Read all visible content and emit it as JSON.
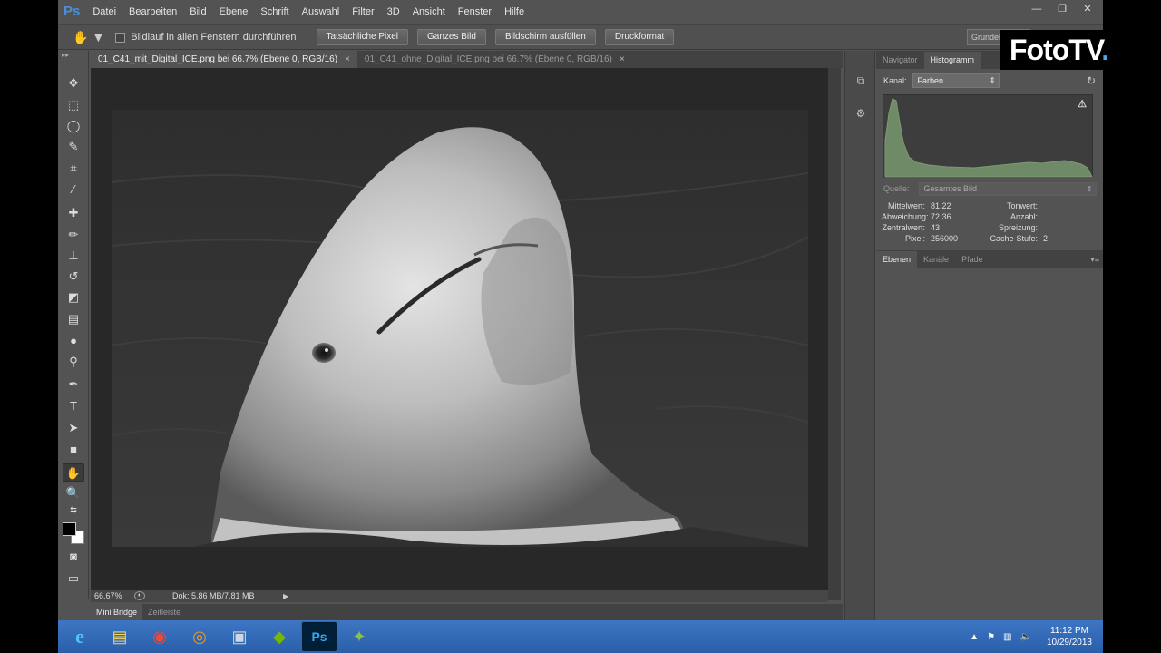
{
  "app": {
    "logo": "Ps"
  },
  "menu": [
    "Datei",
    "Bearbeiten",
    "Bild",
    "Ebene",
    "Schrift",
    "Auswahl",
    "Filter",
    "3D",
    "Ansicht",
    "Fenster",
    "Hilfe"
  ],
  "window_controls": {
    "minimize": "—",
    "restore": "❐",
    "close": "✕"
  },
  "options": {
    "scroll_all_windows_label": "Bildlauf in allen Fenstern durchführen",
    "buttons": [
      "Tatsächliche Pixel",
      "Ganzes Bild",
      "Bildschirm ausfüllen",
      "Druckformat"
    ],
    "workspace": "Grundelemente"
  },
  "tabs": [
    {
      "label": "01_C41_mit_Digital_ICE.png bei 66.7% (Ebene 0, RGB/16)",
      "close": "×",
      "active": true
    },
    {
      "label": "01_C41_ohne_Digital_ICE.png bei 66.7% (Ebene 0, RGB/16)",
      "close": "×",
      "active": false
    }
  ],
  "status": {
    "zoom": "66.67%",
    "doc_size": "Dok: 5.86 MB/7.81 MB",
    "arrow": "▶"
  },
  "bottom_tabs": [
    "Mini Bridge",
    "Zeitleiste"
  ],
  "navigator_tabs": [
    "Navigator",
    "Histogramm"
  ],
  "histogram": {
    "channel_label": "Kanal:",
    "channel_value": "Farben",
    "source_label": "Quelle:",
    "source_value": "Gesamtes Bild",
    "stats_left": [
      {
        "label": "Mittelwert:",
        "value": "81.22"
      },
      {
        "label": "Abweichung:",
        "value": "72.36"
      },
      {
        "label": "Zentralwert:",
        "value": "43"
      },
      {
        "label": "Pixel:",
        "value": "256000"
      }
    ],
    "stats_right": [
      {
        "label": "Tonwert:",
        "value": ""
      },
      {
        "label": "Anzahl:",
        "value": ""
      },
      {
        "label": "Spreizung:",
        "value": ""
      },
      {
        "label": "Cache-Stufe:",
        "value": "2"
      }
    ],
    "fill_color": "#6e8a66"
  },
  "layers_tabs": [
    "Ebenen",
    "Kanäle",
    "Pfade"
  ],
  "taskbar": {
    "apps": [
      "Internet Explorer",
      "Explorer",
      "Chrome",
      "Media",
      "Remote",
      "Nvidia",
      "Photoshop",
      "Tool"
    ],
    "clock_time": "11:12 PM",
    "clock_date": "10/29/2013"
  },
  "watermark": {
    "text": "FotoTV",
    "dot": "."
  }
}
